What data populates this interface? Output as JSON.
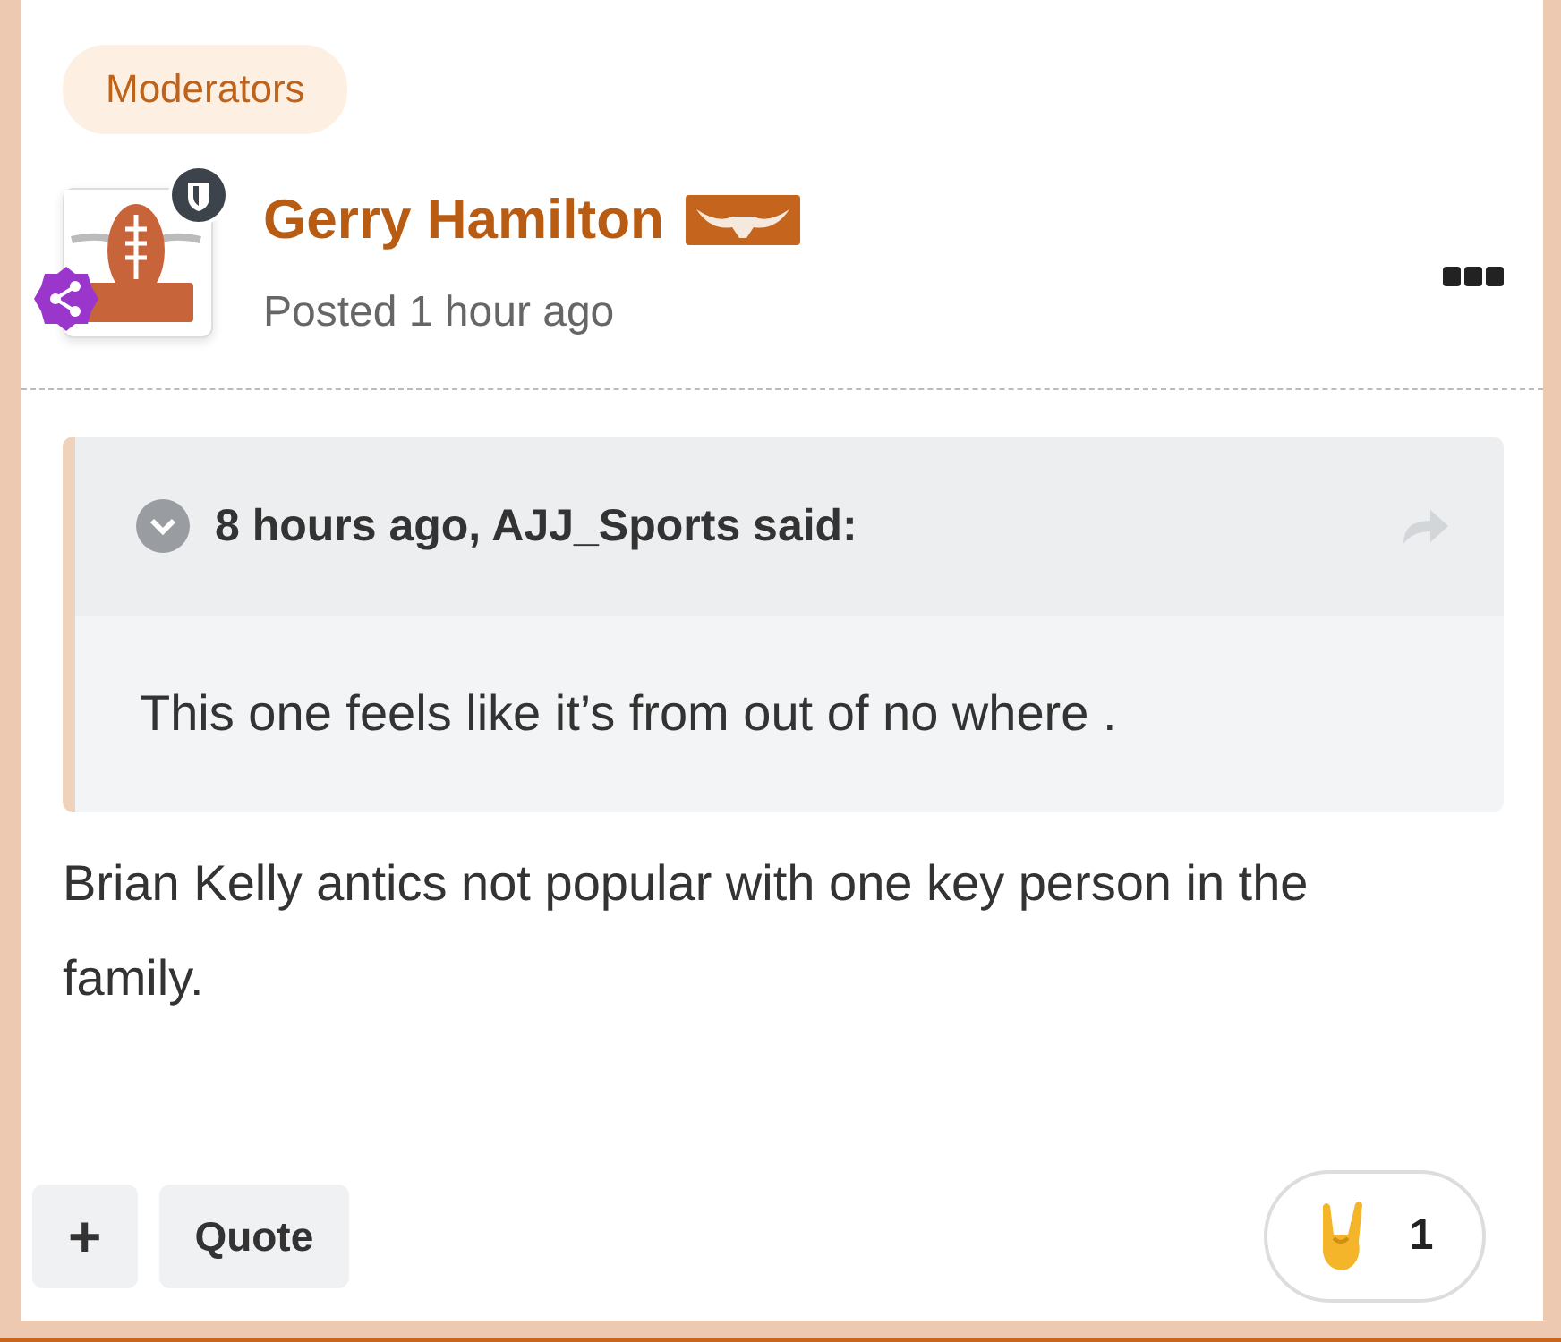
{
  "badge": "Moderators",
  "author": {
    "name": "Gerry Hamilton",
    "posted": "Posted 1 hour ago"
  },
  "quote": {
    "header": "8 hours ago, AJJ_Sports said:",
    "expanded": false,
    "body": "This one feels like it’s from out of no where ."
  },
  "post_text": "Brian Kelly antics not popular with one key person in the family.",
  "actions": [
    {
      "kind": "plus",
      "label": "+"
    },
    {
      "kind": "text",
      "label": "Quote"
    }
  ],
  "reaction": {
    "count": "1"
  }
}
